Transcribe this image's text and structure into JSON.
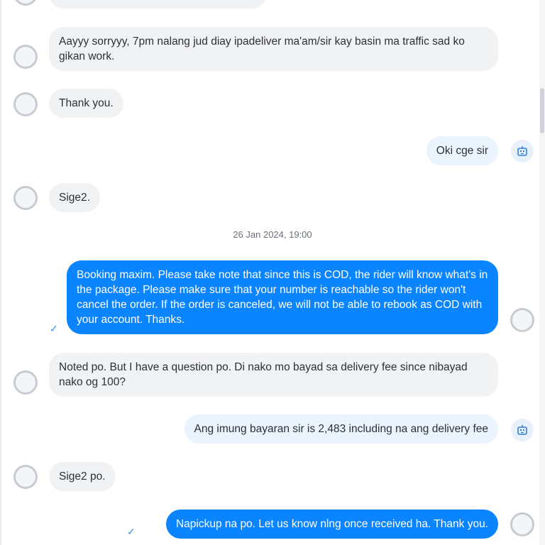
{
  "date_separator": "26 Jan 2024, 19:00",
  "messages": [
    {
      "text": ""
    },
    {
      "text": "Aayyy sorryyy, 7pm nalang jud diay ipadeliver ma'am/sir kay basin ma traffic sad ko gikan work."
    },
    {
      "text": "Thank you."
    },
    {
      "text": "Oki cge sir"
    },
    {
      "text": "Sige2."
    },
    {
      "text": "Booking maxim. Please take note that since this is COD, the rider will know what's in the package. Please make sure that your number is reachable so the rider won't cancel the order. If the order is canceled, we will not be able to rebook as COD with your account. Thanks."
    },
    {
      "text": "Noted po. But I have a question po. Di nako mo bayad sa delivery fee since nibayad nako og 100?"
    },
    {
      "text": "Ang imung bayaran sir is 2,483 including na ang delivery fee"
    },
    {
      "text": "Sige2 po."
    },
    {
      "text": "Napickup na po. Let us know nlng once received ha. Thank you."
    }
  ],
  "icons": {
    "incoming_avatar": "user-avatar-icon",
    "bot": "bot-icon",
    "read_check": "checkmark-icon"
  },
  "colors": {
    "incoming_bubble": "#f1f2f4",
    "outgoing_light_bubble": "#eaf4ff",
    "outgoing_blue_bubble": "#0a84ff",
    "bot_icon": "#2f7fe0"
  }
}
